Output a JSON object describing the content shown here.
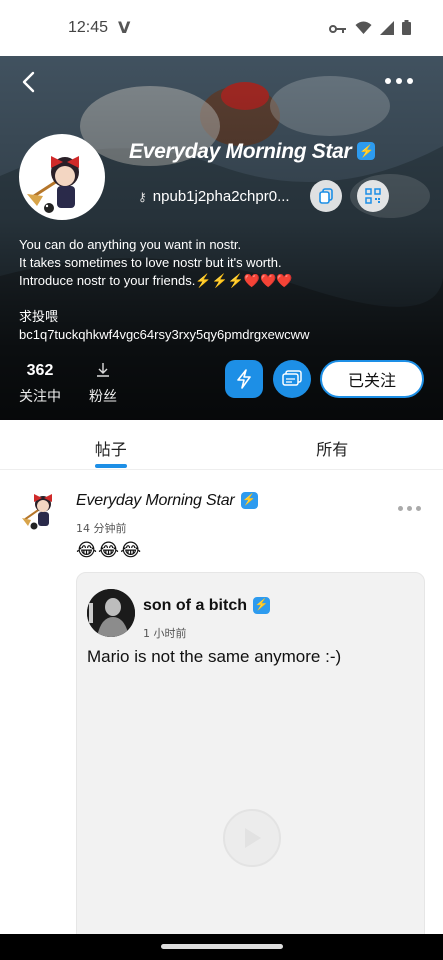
{
  "status_bar": {
    "time": "12:45",
    "app_indicator": "V",
    "icons": [
      "key-icon",
      "wifi-icon",
      "signal-icon",
      "battery-icon"
    ]
  },
  "profile": {
    "name": "Everyday Morning Star",
    "verified_icon": "lightning-badge-icon",
    "npub": "npub1j2pha2chpr0...",
    "about_lines": [
      "You can do anything you want in nostr.",
      "It takes sometimes to love nostr but it's worth.",
      "Introduce nostr to your friends.⚡⚡⚡❤️❤️❤️"
    ],
    "donate_label": "求投喂",
    "lightning_address": "bc1q7tuckqhkwf4vgc64rsy3rxy5qy6pmdrgxewcww",
    "following_count": "362",
    "following_label": "关注中",
    "followers_label": "粉丝",
    "follow_button_label": "已关注"
  },
  "tabs": [
    {
      "label": "帖子",
      "active": true
    },
    {
      "label": "所有",
      "active": false
    }
  ],
  "post": {
    "author": "Everyday Morning Star",
    "time": "14 分钟前",
    "content": "😂😂😂",
    "quoted": {
      "author": "son of a bitch",
      "time": "1 小时前",
      "text": "Mario is not the same anymore :-)"
    }
  },
  "colors": {
    "accent": "#1d8fe6",
    "verified_badge": "#2d9bef"
  }
}
